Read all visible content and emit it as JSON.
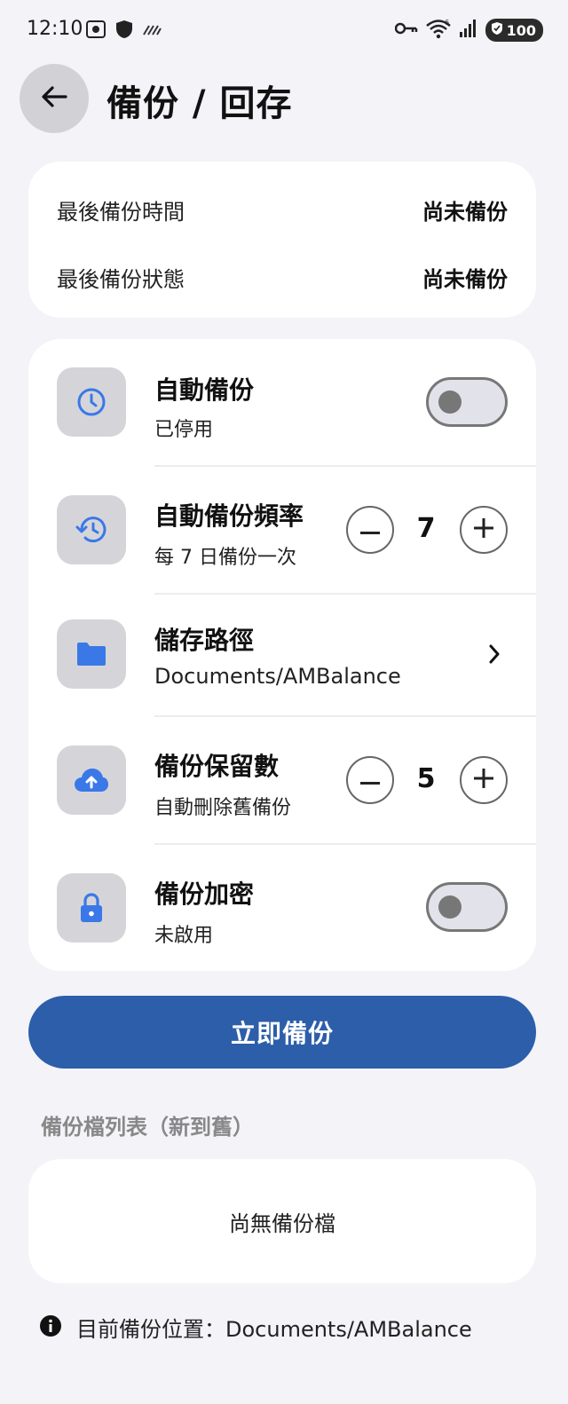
{
  "status_bar": {
    "time": "12:10",
    "battery": "100",
    "network_badge": "6"
  },
  "header": {
    "title": "備份 / 回存"
  },
  "info": {
    "last_backup_time_label": "最後備份時間",
    "last_backup_time_value": "尚未備份",
    "last_backup_status_label": "最後備份狀態",
    "last_backup_status_value": "尚未備份"
  },
  "settings": {
    "auto_backup": {
      "title": "自動備份",
      "subtitle": "已停用",
      "icon": "clock-icon",
      "enabled": false
    },
    "frequency": {
      "title": "自動備份頻率",
      "subtitle": "每 7 日備份一次",
      "icon": "history-icon",
      "value": "7"
    },
    "storage_path": {
      "title": "儲存路徑",
      "subtitle": "Documents/AMBalance",
      "icon": "folder-icon"
    },
    "retention": {
      "title": "備份保留數",
      "subtitle": "自動刪除舊備份",
      "icon": "cloud-upload-icon",
      "value": "5"
    },
    "encryption": {
      "title": "備份加密",
      "subtitle": "未啟用",
      "icon": "lock-icon",
      "enabled": false
    }
  },
  "actions": {
    "backup_now": "立即備份"
  },
  "backup_list": {
    "section_title": "備份檔列表（新到舊）",
    "empty_text": "尚無備份檔"
  },
  "footer": {
    "location_text": "目前備份位置：Documents/AMBalance"
  },
  "colors": {
    "primary": "#2c5eaa",
    "icon_blue": "#3a78e8",
    "background": "#f3f3f8"
  }
}
